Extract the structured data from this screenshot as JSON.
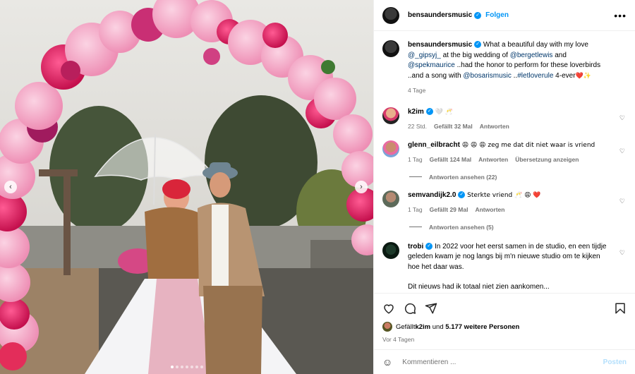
{
  "post": {
    "carousel": {
      "slide_count": 7,
      "active_slide": 1,
      "prev_label": "‹",
      "next_label": "›"
    }
  },
  "header": {
    "username": "bensaundersmusic",
    "follow_label": "Folgen",
    "more_label": "•••"
  },
  "caption": {
    "username": "bensaundersmusic",
    "segments": {
      "s1": " What a beautiful day with my love ",
      "m1": "@_gipsyj_",
      "s2": " at the big wedding of ",
      "m2": "@bergetlewis",
      "s3": " and ",
      "m3": "@spekmaurice",
      "s4": " ..had the honor to perform for these loverbirds ..and a song with ",
      "m4": "@bosarismusic",
      "s5": " ..",
      "m5": "#letloverule",
      "s6": " 4-ever",
      "emoji": "❤️✨"
    },
    "time": "4 Tage"
  },
  "comments": [
    {
      "username": "k2im",
      "text": "🤍 🥂",
      "time": "22 Std.",
      "likes": "Gefällt 32 Mal",
      "reply": "Antworten"
    },
    {
      "username": "glenn_eilbracht",
      "text": "😩 😩 😩 zeg me dat dit niet waar is vriend",
      "time": "1 Tag",
      "likes": "Gefällt 124 Mal",
      "reply": "Antworten",
      "translate": "Übersetzung anzeigen",
      "view_replies": "Antworten ansehen (22)"
    },
    {
      "username": "semvandijk2.0",
      "text": "Sterkte vriend 🥂 😩 ❤️",
      "time": "1 Tag",
      "likes": "Gefällt 29 Mal",
      "reply": "Antworten",
      "view_replies": "Antworten ansehen (5)"
    },
    {
      "username": "trobi",
      "text": " In 2022 voor het eerst samen in de studio, en een tijdje geleden kwam je nog langs bij m'n nieuwe studio om te kijken hoe het daar was.",
      "text2": "Dit nieuws had ik totaal niet zien aankomen..."
    }
  ],
  "likes_line": {
    "prefix": "Gefällt ",
    "user": "k2im",
    "middle": " und ",
    "count": "5.177 weitere Personen"
  },
  "post_time": "Vor 4 Tagen",
  "composer": {
    "placeholder": "Kommentieren ...",
    "post_label": "Posten"
  },
  "colors": {
    "link": "#0095f6",
    "mention": "#00376b",
    "muted": "#737373",
    "like_heart": "#e0245e"
  },
  "icons": [
    "heart-icon",
    "comment-icon",
    "share-icon",
    "bookmark-icon",
    "emoji-icon",
    "verified-icon"
  ]
}
